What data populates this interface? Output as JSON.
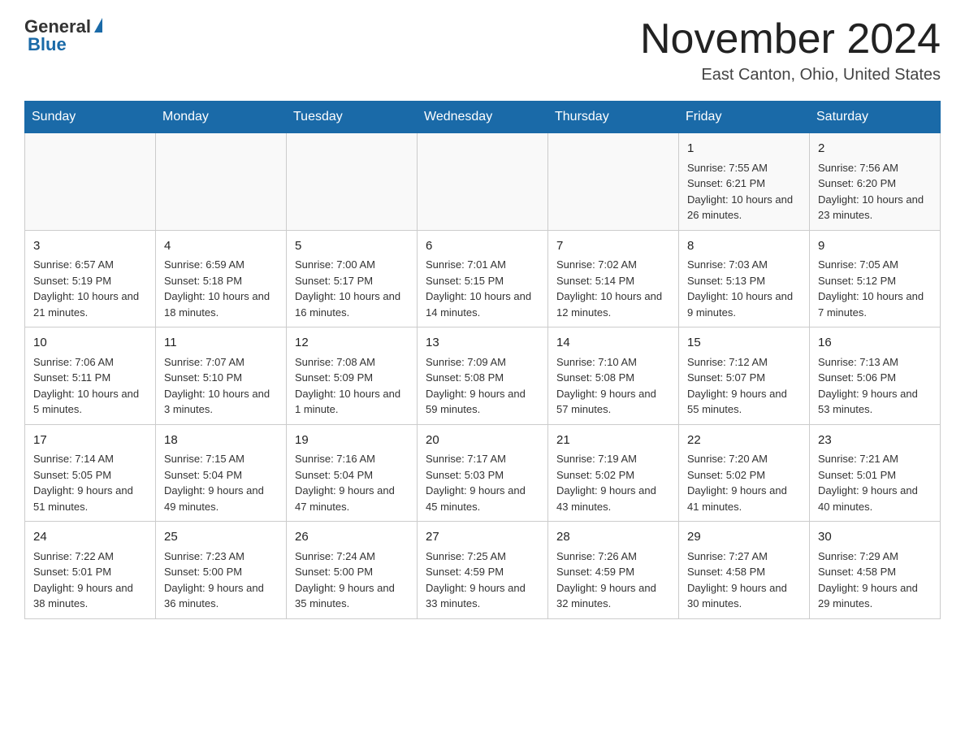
{
  "header": {
    "logo_general": "General",
    "logo_blue": "Blue",
    "month_title": "November 2024",
    "location": "East Canton, Ohio, United States"
  },
  "days_of_week": [
    "Sunday",
    "Monday",
    "Tuesday",
    "Wednesday",
    "Thursday",
    "Friday",
    "Saturday"
  ],
  "weeks": [
    [
      {
        "day": "",
        "sunrise": "",
        "sunset": "",
        "daylight": ""
      },
      {
        "day": "",
        "sunrise": "",
        "sunset": "",
        "daylight": ""
      },
      {
        "day": "",
        "sunrise": "",
        "sunset": "",
        "daylight": ""
      },
      {
        "day": "",
        "sunrise": "",
        "sunset": "",
        "daylight": ""
      },
      {
        "day": "",
        "sunrise": "",
        "sunset": "",
        "daylight": ""
      },
      {
        "day": "1",
        "sunrise": "Sunrise: 7:55 AM",
        "sunset": "Sunset: 6:21 PM",
        "daylight": "Daylight: 10 hours and 26 minutes."
      },
      {
        "day": "2",
        "sunrise": "Sunrise: 7:56 AM",
        "sunset": "Sunset: 6:20 PM",
        "daylight": "Daylight: 10 hours and 23 minutes."
      }
    ],
    [
      {
        "day": "3",
        "sunrise": "Sunrise: 6:57 AM",
        "sunset": "Sunset: 5:19 PM",
        "daylight": "Daylight: 10 hours and 21 minutes."
      },
      {
        "day": "4",
        "sunrise": "Sunrise: 6:59 AM",
        "sunset": "Sunset: 5:18 PM",
        "daylight": "Daylight: 10 hours and 18 minutes."
      },
      {
        "day": "5",
        "sunrise": "Sunrise: 7:00 AM",
        "sunset": "Sunset: 5:17 PM",
        "daylight": "Daylight: 10 hours and 16 minutes."
      },
      {
        "day": "6",
        "sunrise": "Sunrise: 7:01 AM",
        "sunset": "Sunset: 5:15 PM",
        "daylight": "Daylight: 10 hours and 14 minutes."
      },
      {
        "day": "7",
        "sunrise": "Sunrise: 7:02 AM",
        "sunset": "Sunset: 5:14 PM",
        "daylight": "Daylight: 10 hours and 12 minutes."
      },
      {
        "day": "8",
        "sunrise": "Sunrise: 7:03 AM",
        "sunset": "Sunset: 5:13 PM",
        "daylight": "Daylight: 10 hours and 9 minutes."
      },
      {
        "day": "9",
        "sunrise": "Sunrise: 7:05 AM",
        "sunset": "Sunset: 5:12 PM",
        "daylight": "Daylight: 10 hours and 7 minutes."
      }
    ],
    [
      {
        "day": "10",
        "sunrise": "Sunrise: 7:06 AM",
        "sunset": "Sunset: 5:11 PM",
        "daylight": "Daylight: 10 hours and 5 minutes."
      },
      {
        "day": "11",
        "sunrise": "Sunrise: 7:07 AM",
        "sunset": "Sunset: 5:10 PM",
        "daylight": "Daylight: 10 hours and 3 minutes."
      },
      {
        "day": "12",
        "sunrise": "Sunrise: 7:08 AM",
        "sunset": "Sunset: 5:09 PM",
        "daylight": "Daylight: 10 hours and 1 minute."
      },
      {
        "day": "13",
        "sunrise": "Sunrise: 7:09 AM",
        "sunset": "Sunset: 5:08 PM",
        "daylight": "Daylight: 9 hours and 59 minutes."
      },
      {
        "day": "14",
        "sunrise": "Sunrise: 7:10 AM",
        "sunset": "Sunset: 5:08 PM",
        "daylight": "Daylight: 9 hours and 57 minutes."
      },
      {
        "day": "15",
        "sunrise": "Sunrise: 7:12 AM",
        "sunset": "Sunset: 5:07 PM",
        "daylight": "Daylight: 9 hours and 55 minutes."
      },
      {
        "day": "16",
        "sunrise": "Sunrise: 7:13 AM",
        "sunset": "Sunset: 5:06 PM",
        "daylight": "Daylight: 9 hours and 53 minutes."
      }
    ],
    [
      {
        "day": "17",
        "sunrise": "Sunrise: 7:14 AM",
        "sunset": "Sunset: 5:05 PM",
        "daylight": "Daylight: 9 hours and 51 minutes."
      },
      {
        "day": "18",
        "sunrise": "Sunrise: 7:15 AM",
        "sunset": "Sunset: 5:04 PM",
        "daylight": "Daylight: 9 hours and 49 minutes."
      },
      {
        "day": "19",
        "sunrise": "Sunrise: 7:16 AM",
        "sunset": "Sunset: 5:04 PM",
        "daylight": "Daylight: 9 hours and 47 minutes."
      },
      {
        "day": "20",
        "sunrise": "Sunrise: 7:17 AM",
        "sunset": "Sunset: 5:03 PM",
        "daylight": "Daylight: 9 hours and 45 minutes."
      },
      {
        "day": "21",
        "sunrise": "Sunrise: 7:19 AM",
        "sunset": "Sunset: 5:02 PM",
        "daylight": "Daylight: 9 hours and 43 minutes."
      },
      {
        "day": "22",
        "sunrise": "Sunrise: 7:20 AM",
        "sunset": "Sunset: 5:02 PM",
        "daylight": "Daylight: 9 hours and 41 minutes."
      },
      {
        "day": "23",
        "sunrise": "Sunrise: 7:21 AM",
        "sunset": "Sunset: 5:01 PM",
        "daylight": "Daylight: 9 hours and 40 minutes."
      }
    ],
    [
      {
        "day": "24",
        "sunrise": "Sunrise: 7:22 AM",
        "sunset": "Sunset: 5:01 PM",
        "daylight": "Daylight: 9 hours and 38 minutes."
      },
      {
        "day": "25",
        "sunrise": "Sunrise: 7:23 AM",
        "sunset": "Sunset: 5:00 PM",
        "daylight": "Daylight: 9 hours and 36 minutes."
      },
      {
        "day": "26",
        "sunrise": "Sunrise: 7:24 AM",
        "sunset": "Sunset: 5:00 PM",
        "daylight": "Daylight: 9 hours and 35 minutes."
      },
      {
        "day": "27",
        "sunrise": "Sunrise: 7:25 AM",
        "sunset": "Sunset: 4:59 PM",
        "daylight": "Daylight: 9 hours and 33 minutes."
      },
      {
        "day": "28",
        "sunrise": "Sunrise: 7:26 AM",
        "sunset": "Sunset: 4:59 PM",
        "daylight": "Daylight: 9 hours and 32 minutes."
      },
      {
        "day": "29",
        "sunrise": "Sunrise: 7:27 AM",
        "sunset": "Sunset: 4:58 PM",
        "daylight": "Daylight: 9 hours and 30 minutes."
      },
      {
        "day": "30",
        "sunrise": "Sunrise: 7:29 AM",
        "sunset": "Sunset: 4:58 PM",
        "daylight": "Daylight: 9 hours and 29 minutes."
      }
    ]
  ]
}
